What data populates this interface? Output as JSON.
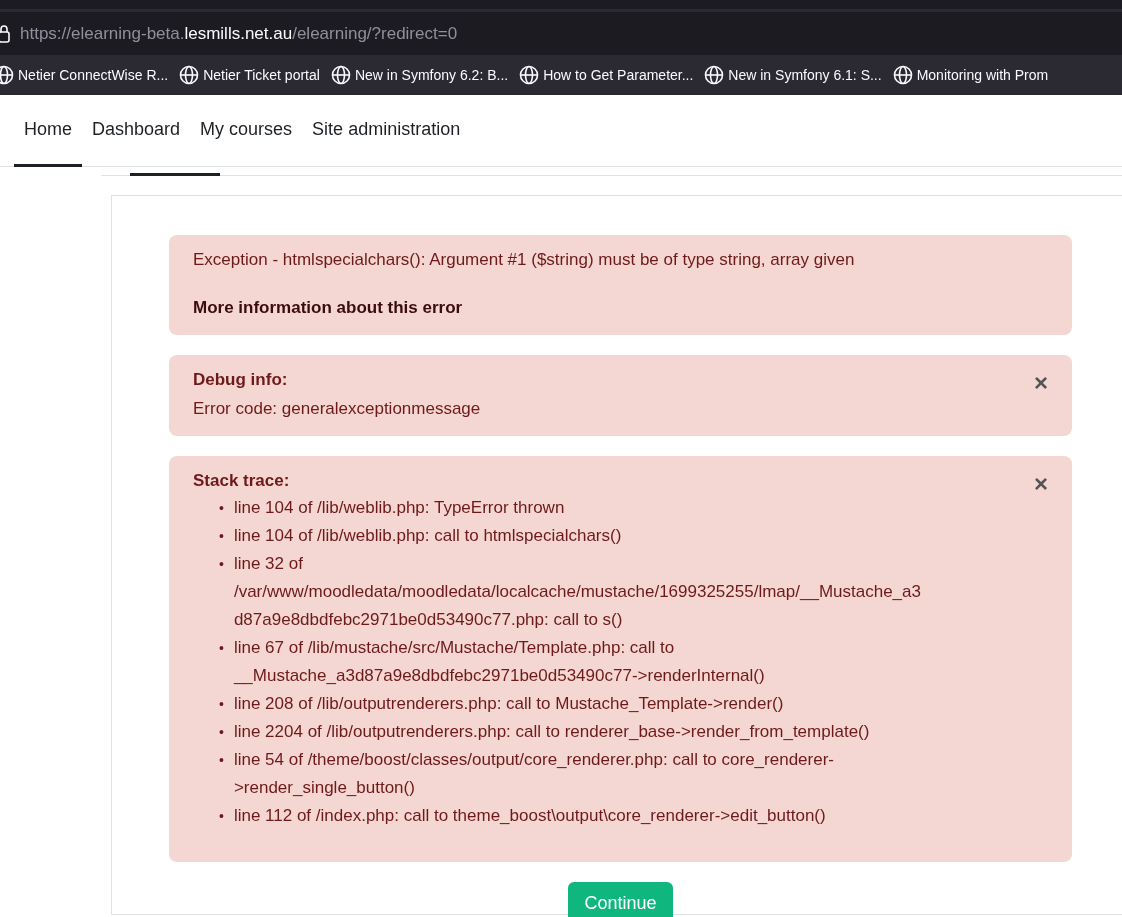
{
  "address_bar": {
    "url_scheme": "https://elearning-beta.",
    "url_host": "lesmills.net.au",
    "url_path": "/elearning/?redirect=0"
  },
  "bookmarks": [
    "Netier ConnectWise R...",
    "Netier Ticket portal",
    "New in Symfony 6.2: B...",
    "How to Get Parameter...",
    "New in Symfony 6.1: S...",
    "Monitoring with Prom"
  ],
  "nav": [
    {
      "label": "Home",
      "selected": true
    },
    {
      "label": "Dashboard",
      "selected": false
    },
    {
      "label": "My courses",
      "selected": false
    },
    {
      "label": "Site administration",
      "selected": false
    }
  ],
  "error": {
    "message": "Exception - htmlspecialchars(): Argument #1 ($string) must be of type string, array given",
    "more_info": "More information about this error"
  },
  "debug": {
    "title": "Debug info:",
    "text": "Error code: generalexceptionmessage",
    "close": "×"
  },
  "stack": {
    "title": "Stack trace:",
    "close": "×",
    "bullet": "•",
    "lines": [
      "line 104 of /lib/weblib.php: TypeError thrown",
      "line 104 of /lib/weblib.php: call to htmlspecialchars()",
      "line 32 of /var/www/moodledata/moodledata/localcache/mustache/1699325255/lmap/__Mustache_a3d87a9e8dbdfebc2971be0d53490c77.php: call to s()",
      "line 67 of /lib/mustache/src/Mustache/Template.php: call to __Mustache_a3d87a9e8dbdfebc2971be0d53490c77->renderInternal()",
      "line 208 of /lib/outputrenderers.php: call to Mustache_Template->render()",
      "line 2204 of /lib/outputrenderers.php: call to renderer_base->render_from_template()",
      "line 54 of /theme/boost/classes/output/core_renderer.php: call to core_renderer->render_single_button()",
      "line 112 of /index.php: call to theme_boost\\output\\core_renderer->edit_button()"
    ]
  },
  "continue_button": "Continue"
}
